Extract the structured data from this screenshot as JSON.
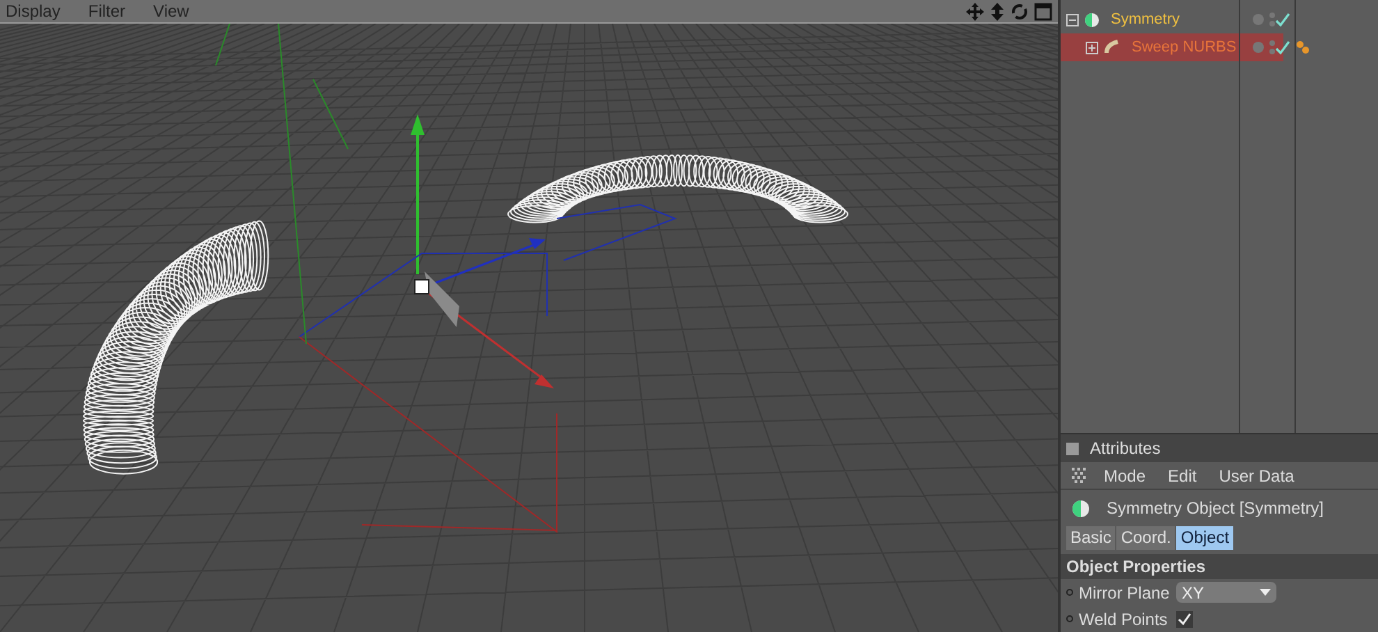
{
  "viewport": {
    "menu": [
      "Display",
      "Filter",
      "View"
    ]
  },
  "objects": [
    {
      "name": "Symmetry",
      "selected": false,
      "expanded": true,
      "checked": true,
      "kind": "symmetry",
      "children": [
        {
          "name": "Sweep NURBS",
          "selected": true,
          "expanded": false,
          "checked": true,
          "kind": "sweep",
          "tags": true
        }
      ]
    }
  ],
  "attributes": {
    "title": "Attributes",
    "menu": [
      "Mode",
      "Edit",
      "User Data"
    ],
    "object_title": "Symmetry Object [Symmetry]",
    "tabs": [
      {
        "label": "Basic",
        "selected": false
      },
      {
        "label": "Coord.",
        "selected": false
      },
      {
        "label": "Object",
        "selected": true
      }
    ],
    "section": "Object Properties",
    "fields": [
      {
        "label": "Mirror Plane",
        "kind": "dropdown",
        "value": "XY"
      },
      {
        "label": "Weld Points",
        "kind": "checkbox",
        "checked": true
      }
    ]
  }
}
